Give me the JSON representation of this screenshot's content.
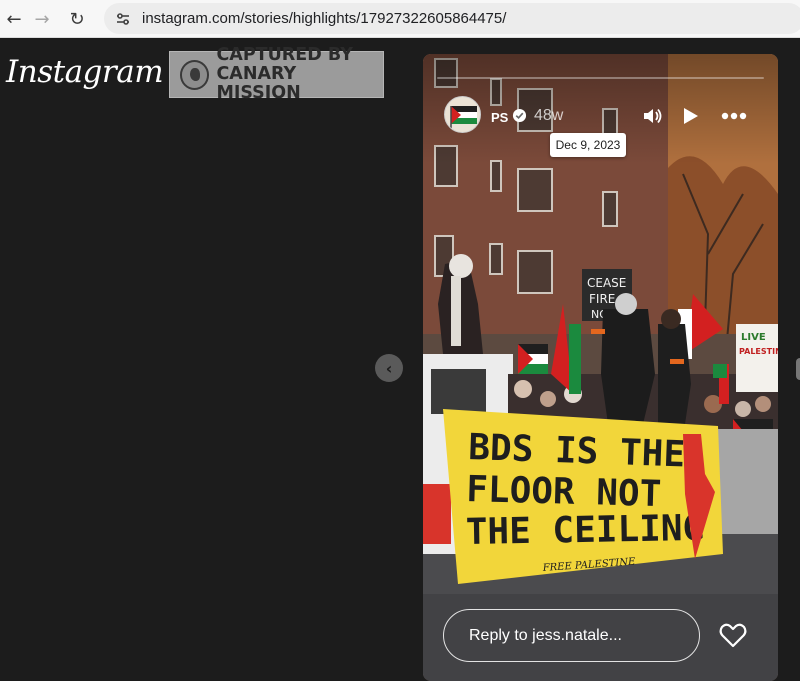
{
  "browser": {
    "url": "instagram.com/stories/highlights/17927322605864475/",
    "icons": {
      "back": "arrow-left-icon",
      "forward": "arrow-right-icon",
      "reload": "reload-icon",
      "site_info": "tune-icon"
    }
  },
  "page": {
    "logo": "Instagram",
    "watermark": {
      "line1": "CAPTURED BY",
      "line2": "CANARY MISSION"
    },
    "prev_icon": "chevron-left-icon"
  },
  "story": {
    "username": "PS",
    "time_ago": "48w",
    "date_tooltip": "Dec 9, 2023",
    "progress": 0.0,
    "reply_placeholder": "Reply to jess.natale...",
    "controls": [
      "volume-icon",
      "play-icon",
      "more-icon"
    ],
    "scene_text": {
      "sign": [
        "CEASE",
        "FIRE",
        "NOW"
      ],
      "banner": [
        "BDS IS THE",
        "FLOOR NOT",
        "THE CEILING"
      ],
      "banner_small": "FREE PALESTINE",
      "side_sign": [
        "LIVE",
        "PALESTINE"
      ]
    }
  },
  "colors": {
    "banner": "#f2d63a",
    "banner_text": "#1e1e1e",
    "brick": "#7b4a3a"
  }
}
